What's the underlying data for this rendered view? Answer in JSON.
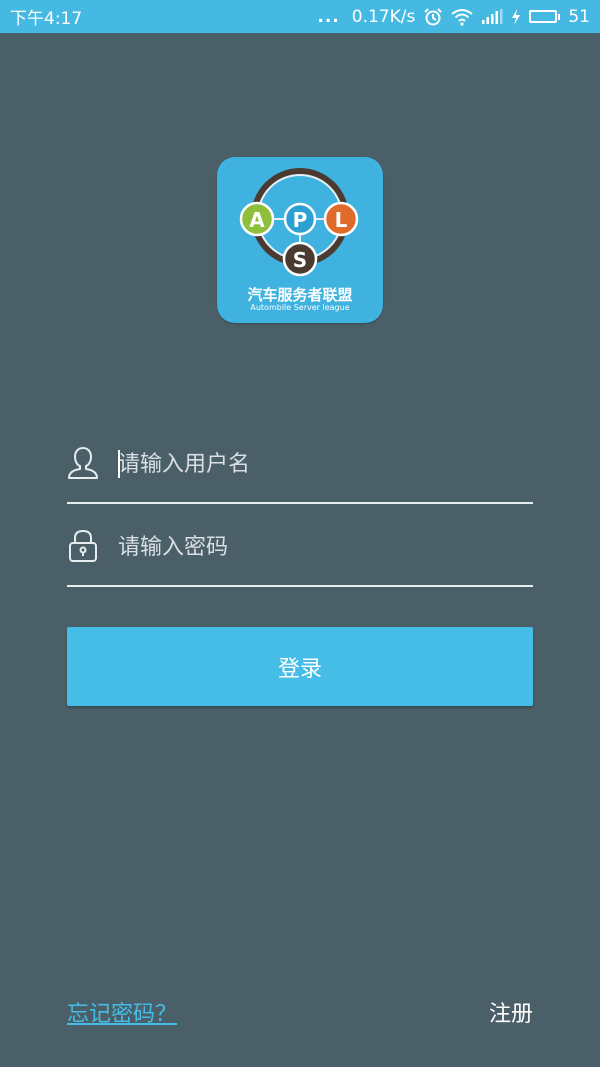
{
  "status_bar": {
    "time": "下午4:17",
    "dots": "...",
    "net_speed": "0.17K/s",
    "battery_level": "51",
    "battery_fill_percent": 60,
    "icons": [
      "alarm-icon",
      "wifi-icon",
      "signal-icon",
      "charging-icon",
      "battery-icon"
    ]
  },
  "logo": {
    "letters": [
      "A",
      "P",
      "L",
      "S"
    ],
    "title": "汽车服务者联盟",
    "subtitle": "Autombile Server league",
    "colors": {
      "background": "#3fb2df",
      "A": "#8dbf3a",
      "P": "#2d9fd3",
      "L": "#e06a2a",
      "S": "#4a3a30"
    }
  },
  "form": {
    "username": {
      "placeholder": "请输入用户名",
      "value": "",
      "icon": "user-icon"
    },
    "password": {
      "placeholder": "请输入密码",
      "value": "",
      "icon": "lock-icon"
    },
    "login_label": "登录"
  },
  "links": {
    "forgot_password": "忘记密码？",
    "register": "注册"
  },
  "colors": {
    "background": "#4a5f68",
    "accent": "#45bde6",
    "status_bar": "#45b9e2"
  }
}
